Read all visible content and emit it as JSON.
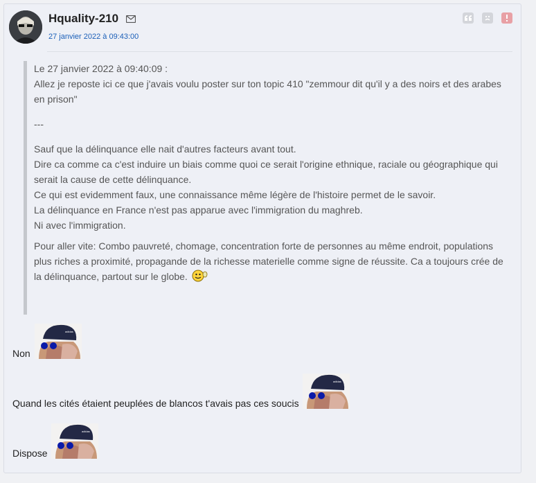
{
  "post": {
    "author": "Hquality-210",
    "date": "27 janvier 2022 à 09:43:00",
    "actions": [
      "quote-icon",
      "sad-face-icon",
      "report-icon"
    ]
  },
  "quote": {
    "header": "Le 27 janvier 2022 à 09:40:09 :",
    "intro_1": "Allez je reposte ici ce que j'avais voulu poster sur ton topic 410 \"zemmour dit qu'il y a des noirs et des arabes",
    "intro_2": "en prison\"",
    "separator": "---",
    "para1": [
      "Sauf que la délinquance elle nait d'autres facteurs avant tout.",
      "Dire ca comme ca c'est induire un biais comme quoi ce serait l'origine ethnique, raciale ou géographique qui",
      "serait la cause de cette délinquance.",
      "Ce qui est evidemment faux, une connaissance même légère de l'histoire permet de le savoir.",
      "La délinquance en France n'est pas apparue avec l'immigration du maghreb.",
      "Ni avec l'immigration."
    ],
    "para2": [
      "Pour aller vite: Combo pauvreté, chomage, concentration forte de personnes au même endroit, populations",
      "plus riches a proximité, propagande de la richesse materielle comme signe de réussite. Ca a toujours crée de",
      "la délinquance, partout sur le globe."
    ]
  },
  "replies": [
    "Non",
    "Quand les cités étaient peuplées de blancos t'avais pas ces soucis",
    "Dispose"
  ],
  "colors": {
    "accent": "#1b5fb8",
    "report": "#e8a0a5"
  }
}
